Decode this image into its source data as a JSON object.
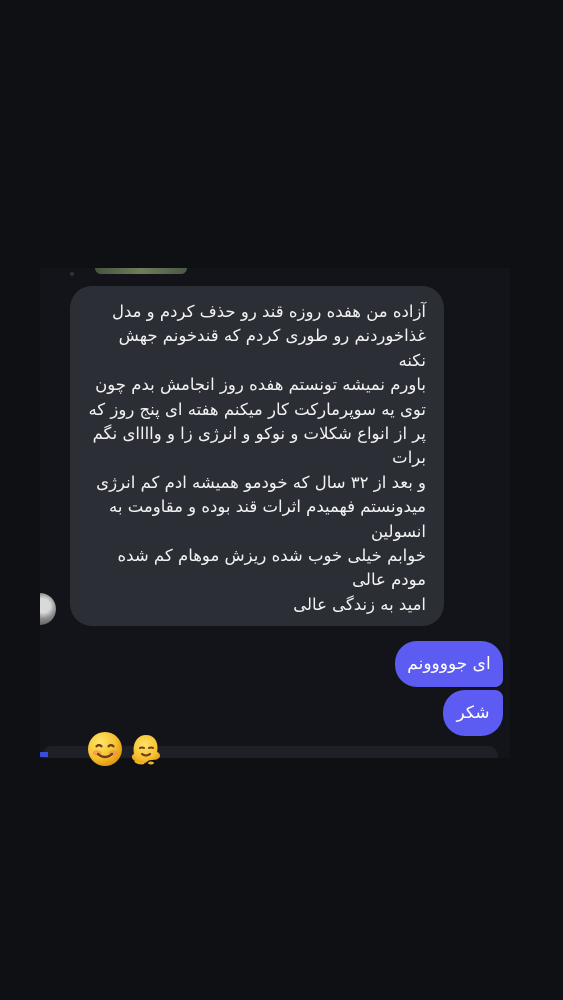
{
  "chat": {
    "incoming_message": {
      "lines": [
        "آزاده من هفده روزه قند رو حذف کردم و مدل غذاخوردنم رو طوری کردم که قندخونم جهش نکنه",
        "باورم نمیشه تونستم هفده روز انجامش بدم چون توی یه سوپرمارکت کار میکنم هفته ای پنج روز که پر از انواع شکلات و نوکو و انرژی زا و واااای نگم برات",
        "و بعد از ۳۲ سال که خودمو همیشه ادم کم انرژی میدونستم فهمیدم اثرات قند بوده و مقاومت به انسولین",
        "خوابم خیلی خوب شده ریزش موهام کم شده مودم عالی",
        "امید به زندگی عالی"
      ]
    },
    "outgoing_messages": [
      "ای جوووونم",
      "شکر"
    ],
    "reactions": {
      "icons": [
        "smiling-face-emoji",
        "melting-face-emoji"
      ]
    }
  },
  "colors": {
    "background": "#0e1014",
    "incoming_bubble": "#2b2e35",
    "outgoing_bubble": "#5d5cf2"
  }
}
